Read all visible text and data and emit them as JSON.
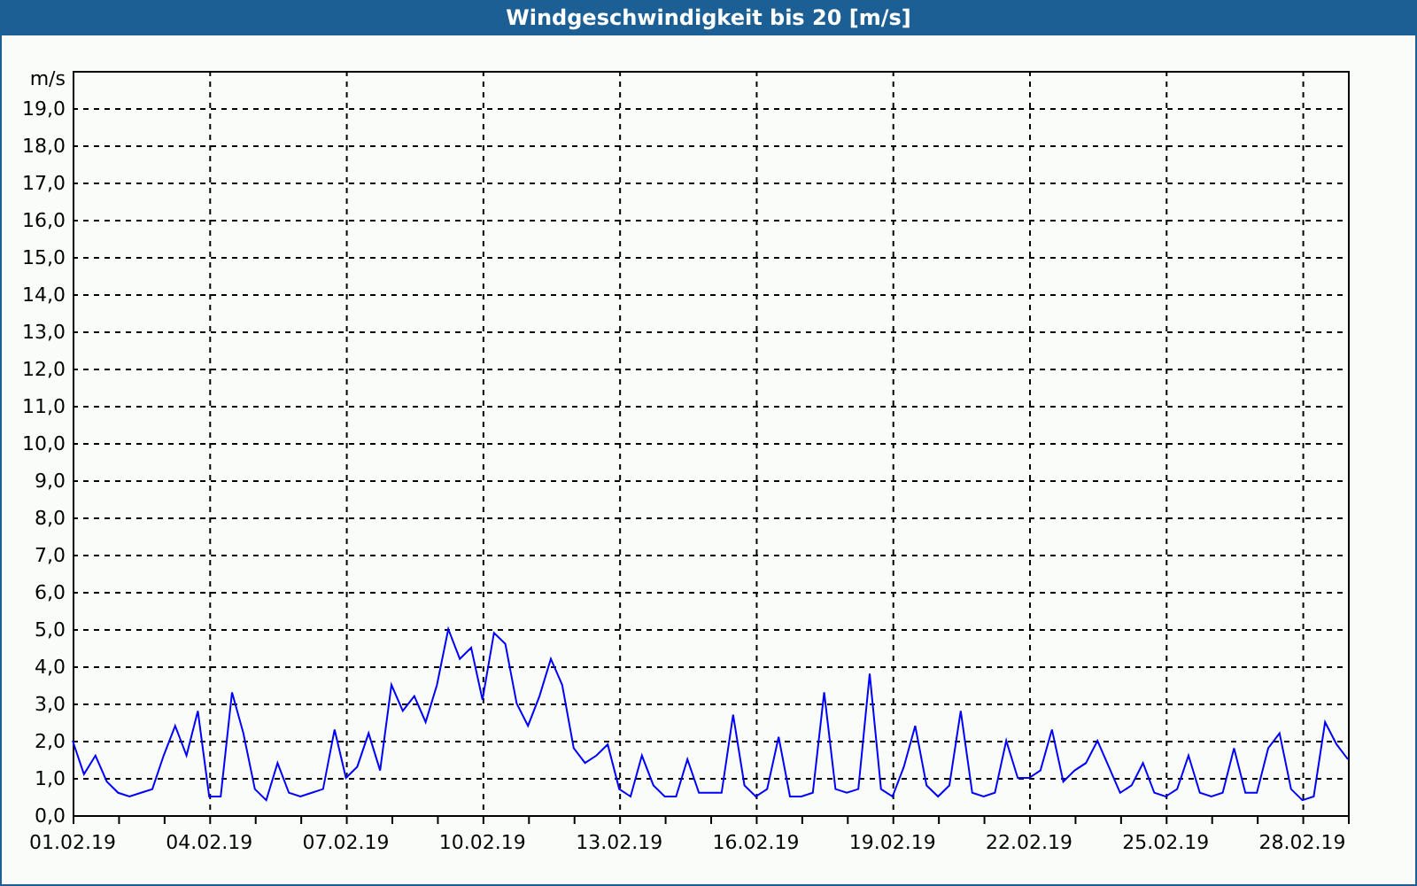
{
  "window": {
    "title": "Windgeschwindigkeit bis 20 [m/s]"
  },
  "chart_data": {
    "type": "line",
    "grid": true,
    "ylabel": "m/s",
    "ylim": [
      0,
      20
    ],
    "yticks": [
      {
        "value": 0,
        "label": "0,0"
      },
      {
        "value": 1,
        "label": "1,0"
      },
      {
        "value": 2,
        "label": "2,0"
      },
      {
        "value": 3,
        "label": "3,0"
      },
      {
        "value": 4,
        "label": "4,0"
      },
      {
        "value": 5,
        "label": "5,0"
      },
      {
        "value": 6,
        "label": "6,0"
      },
      {
        "value": 7,
        "label": "7,0"
      },
      {
        "value": 8,
        "label": "8,0"
      },
      {
        "value": 9,
        "label": "9,0"
      },
      {
        "value": 10,
        "label": "10,0"
      },
      {
        "value": 11,
        "label": "11,0"
      },
      {
        "value": 12,
        "label": "12,0"
      },
      {
        "value": 13,
        "label": "13,0"
      },
      {
        "value": 14,
        "label": "14,0"
      },
      {
        "value": 15,
        "label": "15,0"
      },
      {
        "value": 16,
        "label": "16,0"
      },
      {
        "value": 17,
        "label": "17,0"
      },
      {
        "value": 18,
        "label": "18,0"
      },
      {
        "value": 19,
        "label": "19,0"
      }
    ],
    "categories": [
      "01.02.19",
      null,
      null,
      null,
      null,
      null,
      null,
      null,
      null,
      null,
      null,
      null,
      "04.02.19",
      null,
      null,
      null,
      null,
      null,
      null,
      null,
      null,
      null,
      null,
      null,
      "07.02.19",
      null,
      null,
      null,
      null,
      null,
      null,
      null,
      null,
      null,
      null,
      null,
      "10.02.19",
      null,
      null,
      null,
      null,
      null,
      null,
      null,
      null,
      null,
      null,
      null,
      "13.02.19",
      null,
      null,
      null,
      null,
      null,
      null,
      null,
      null,
      null,
      null,
      null,
      "16.02.19",
      null,
      null,
      null,
      null,
      null,
      null,
      null,
      null,
      null,
      null,
      null,
      "19.02.19",
      null,
      null,
      null,
      null,
      null,
      null,
      null,
      null,
      null,
      null,
      null,
      "22.02.19",
      null,
      null,
      null,
      null,
      null,
      null,
      null,
      null,
      null,
      null,
      null,
      "25.02.19",
      null,
      null,
      null,
      null,
      null,
      null,
      null,
      null,
      null,
      null,
      null,
      "28.02.19",
      null,
      null,
      null,
      null
    ],
    "series": [
      {
        "color": "#0000ff",
        "values": [
          2.0,
          1.1,
          1.6,
          0.9,
          0.6,
          0.5,
          0.6,
          0.7,
          1.6,
          2.4,
          1.6,
          2.8,
          0.5,
          0.5,
          3.3,
          2.2,
          0.7,
          0.4,
          1.4,
          0.6,
          0.5,
          0.6,
          0.7,
          2.3,
          1.0,
          1.3,
          2.2,
          1.2,
          3.5,
          2.8,
          3.2,
          2.5,
          3.5,
          5.0,
          4.2,
          4.5,
          3.1,
          4.9,
          4.6,
          3.0,
          2.4,
          3.2,
          4.2,
          3.5,
          1.8,
          1.4,
          1.6,
          1.9,
          0.7,
          0.5,
          1.6,
          0.8,
          0.5,
          0.5,
          1.5,
          0.6,
          0.6,
          0.6,
          2.7,
          0.8,
          0.5,
          0.7,
          2.1,
          0.5,
          0.5,
          0.6,
          3.3,
          0.7,
          0.6,
          0.7,
          3.8,
          0.7,
          0.5,
          1.3,
          2.4,
          0.8,
          0.5,
          0.8,
          2.8,
          0.6,
          0.5,
          0.6,
          2.0,
          1.0,
          1.0,
          1.2,
          2.3,
          0.9,
          1.2,
          1.4,
          2.0,
          1.3,
          0.6,
          0.8,
          1.4,
          0.6,
          0.5,
          0.7,
          1.6,
          0.6,
          0.5,
          0.6,
          1.8,
          0.6,
          0.6,
          1.8,
          2.2,
          0.7,
          0.4,
          0.5,
          2.5,
          1.9,
          1.5
        ]
      }
    ]
  }
}
